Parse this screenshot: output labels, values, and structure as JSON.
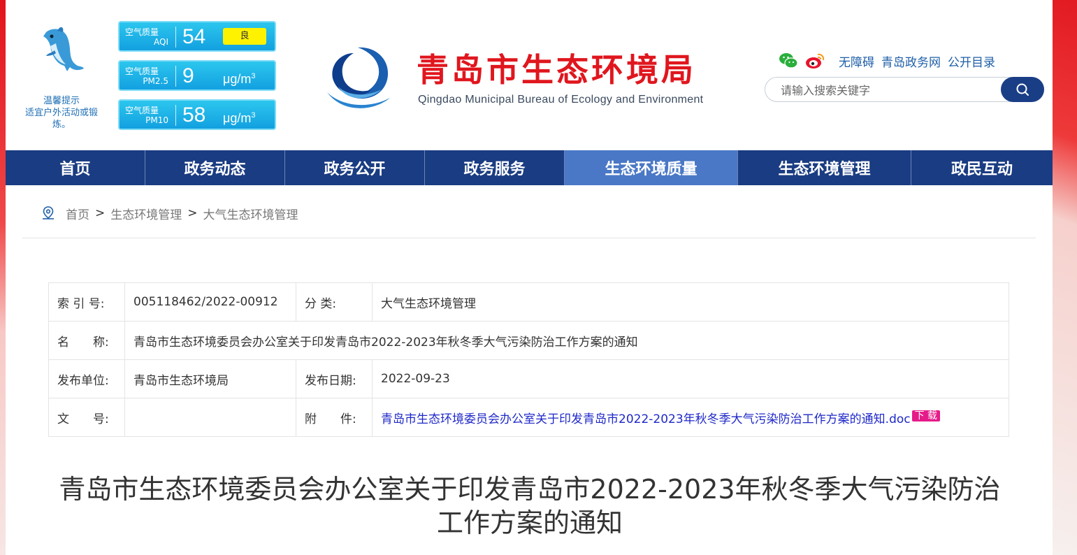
{
  "weather_tip": {
    "title": "温馨提示",
    "text": "适宜户外活动或锻炼。"
  },
  "air_quality": [
    {
      "label_top": "空气质量",
      "label_bottom": "AQI",
      "value": "54",
      "badge": "良"
    },
    {
      "label_top": "空气质量",
      "label_bottom": "PM2.5",
      "value": "9",
      "unit": "μg/m",
      "unit_sup": "3"
    },
    {
      "label_top": "空气质量",
      "label_bottom": "PM10",
      "value": "58",
      "unit": "μg/m",
      "unit_sup": "3"
    }
  ],
  "site": {
    "title_cn": "青岛市生态环境局",
    "title_en": "Qingdao Municipal Bureau of Ecology and Environment"
  },
  "toplinks": {
    "icons": [
      "wechat-icon",
      "weibo-icon"
    ],
    "items": [
      "无障碍",
      "青岛政务网",
      "公开目录"
    ]
  },
  "search": {
    "placeholder": "请输入搜索关键字"
  },
  "nav": [
    {
      "label": "首页"
    },
    {
      "label": "政务动态"
    },
    {
      "label": "政务公开"
    },
    {
      "label": "政务服务"
    },
    {
      "label": "生态环境质量",
      "active": true
    },
    {
      "label": "生态环境管理"
    },
    {
      "label": "政民互动"
    }
  ],
  "breadcrumb": [
    "首页",
    "生态环境管理",
    "大气生态环境管理"
  ],
  "breadcrumb_sep": ">",
  "info": {
    "index_label": "索 引 号:",
    "index_value": "005118462/2022-00912",
    "category_label": "分 类:",
    "category_value": "大气生态环境管理",
    "name_label": "名　　称:",
    "name_value": "青岛市生态环境委员会办公室关于印发青岛市2022-2023年秋冬季大气污染防治工作方案的通知",
    "publisher_label": "发布单位:",
    "publisher_value": "青岛市生态环境局",
    "date_label": "发布日期:",
    "date_value": "2022-09-23",
    "docno_label": "文　　号:",
    "docno_value": "",
    "attach_label": "附　　件:",
    "attach_value": "青岛市生态环境委员会办公室关于印发青岛市2022-2023年秋冬季大气污染防治工作方案的通知.doc",
    "download_label": "下 载"
  },
  "doc_title": "青岛市生态环境委员会办公室关于印发青岛市2022-2023年秋冬季大气污染防治工作方案的通知",
  "colors": {
    "nav_bg": "#1a3c82",
    "nav_active": "#4a78c6",
    "title_red": "#e0161e",
    "aqi_blue": "#12a0e0",
    "badge_yellow": "#fff200"
  }
}
